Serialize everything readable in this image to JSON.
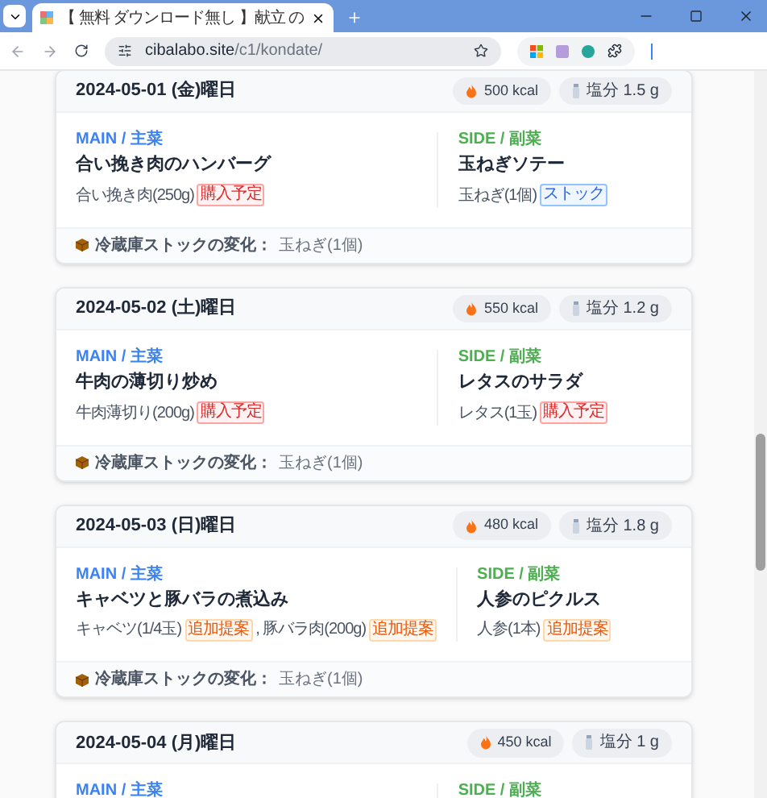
{
  "browser": {
    "tab_title": "【 無料 ダウンロード無し 】献立 の",
    "url_host": "cibalabo.site",
    "url_path": "/c1/kondate/"
  },
  "days": [
    {
      "date": "2024-05-01 (金)曜日",
      "kcal": "500 kcal",
      "salt": "塩分 1.5 g",
      "main": {
        "label": "MAIN / 主菜",
        "title": "合い挽き肉のハンバーグ",
        "ingredients": [
          {
            "name": "合い挽き肉(250g)",
            "tag": "購入予定",
            "kind": "purchase"
          }
        ]
      },
      "side": {
        "label": "SIDE / 副菜",
        "title": "玉ねぎソテー",
        "ingredients": [
          {
            "name": "玉ねぎ(1個)",
            "tag": "ストック",
            "kind": "stock"
          }
        ]
      },
      "stock_label": "冷蔵庫ストックの変化：",
      "stock_value": "玉ねぎ(1個)"
    },
    {
      "date": "2024-05-02 (土)曜日",
      "kcal": "550 kcal",
      "salt": "塩分 1.2 g",
      "main": {
        "label": "MAIN / 主菜",
        "title": "牛肉の薄切り炒め",
        "ingredients": [
          {
            "name": "牛肉薄切り(200g)",
            "tag": "購入予定",
            "kind": "purchase"
          }
        ]
      },
      "side": {
        "label": "SIDE / 副菜",
        "title": "レタスのサラダ",
        "ingredients": [
          {
            "name": "レタス(1玉)",
            "tag": "購入予定",
            "kind": "purchase"
          }
        ]
      },
      "stock_label": "冷蔵庫ストックの変化：",
      "stock_value": "玉ねぎ(1個)"
    },
    {
      "date": "2024-05-03 (日)曜日",
      "kcal": "480 kcal",
      "salt": "塩分 1.8 g",
      "main": {
        "label": "MAIN / 主菜",
        "title": "キャベツと豚バラの煮込み",
        "ingredients": [
          {
            "name": "キャベツ(1/4玉)",
            "tag": "追加提案",
            "kind": "suggest"
          },
          {
            "name": ", 豚バラ肉(200g)",
            "tag": "追加提案",
            "kind": "suggest"
          }
        ]
      },
      "side": {
        "label": "SIDE / 副菜",
        "title": "人参のピクルス",
        "ingredients": [
          {
            "name": "人参(1本)",
            "tag": "追加提案",
            "kind": "suggest"
          }
        ]
      },
      "stock_label": "冷蔵庫ストックの変化：",
      "stock_value": "玉ねぎ(1個)"
    },
    {
      "date": "2024-05-04 (月)曜日",
      "kcal": "450 kcal",
      "salt": "塩分 1 g",
      "main": {
        "label": "MAIN / 主菜"
      },
      "side": {
        "label": "SIDE / 副菜"
      }
    }
  ]
}
